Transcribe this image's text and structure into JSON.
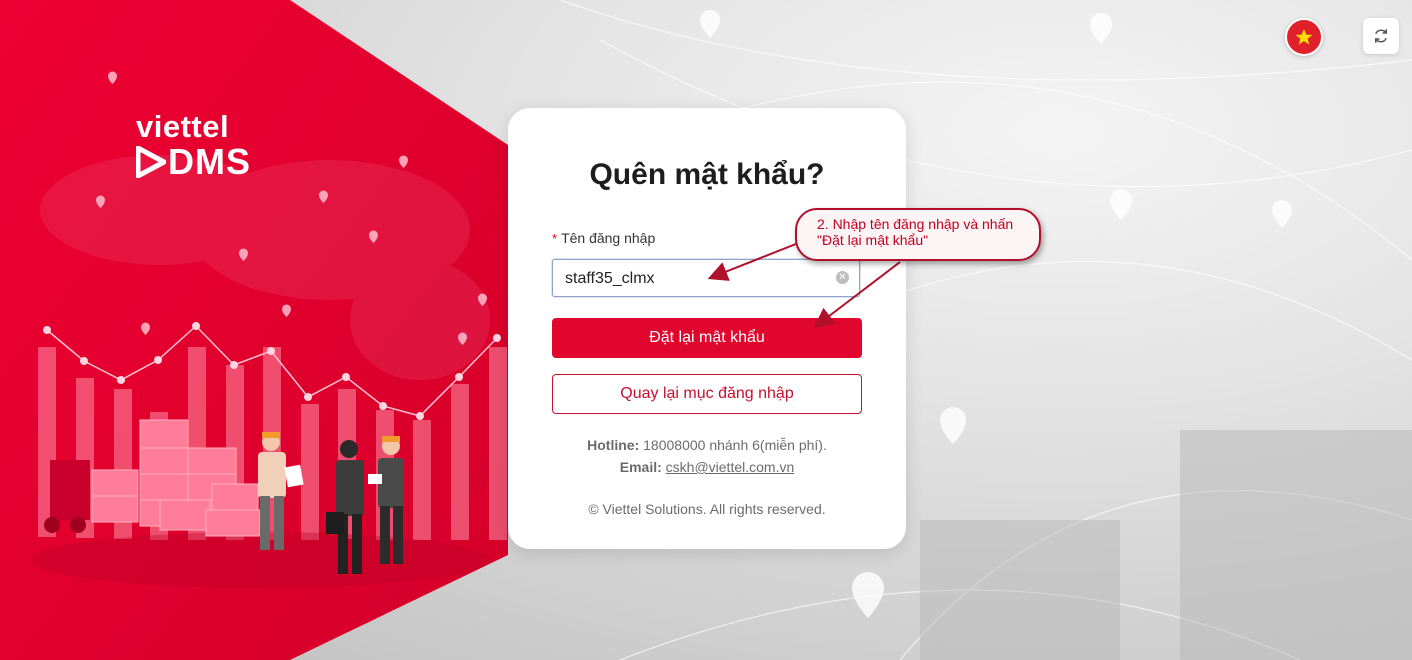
{
  "brand": {
    "logo_top": "viettel",
    "logo_bottom": "DMS"
  },
  "header": {
    "language_icon": "vietnam-flag-icon",
    "refresh_icon": "refresh-icon"
  },
  "form": {
    "title": "Quên mật khẩu?",
    "required_mark": "*",
    "username_label": "Tên đăng nhập",
    "username_value": "staff35_clmx",
    "clear_icon": "clear-icon",
    "reset_button": "Đặt lại mật khẩu",
    "back_button": "Quay lại mục đăng nhập"
  },
  "contact": {
    "hotline_label": "Hotline:",
    "hotline_value": "18008000 nhánh 6(miễn phí).",
    "email_label": "Email:",
    "email_value": "cskh@viettel.com.vn",
    "copyright": "© Viettel Solutions. All rights reserved."
  },
  "annotation": {
    "text": "2. Nhập tên đăng nhập và nhấn \"Đặt lại mật khẩu\""
  },
  "colors": {
    "brand_red": "#e0062d",
    "outline_red": "#c8102e"
  }
}
